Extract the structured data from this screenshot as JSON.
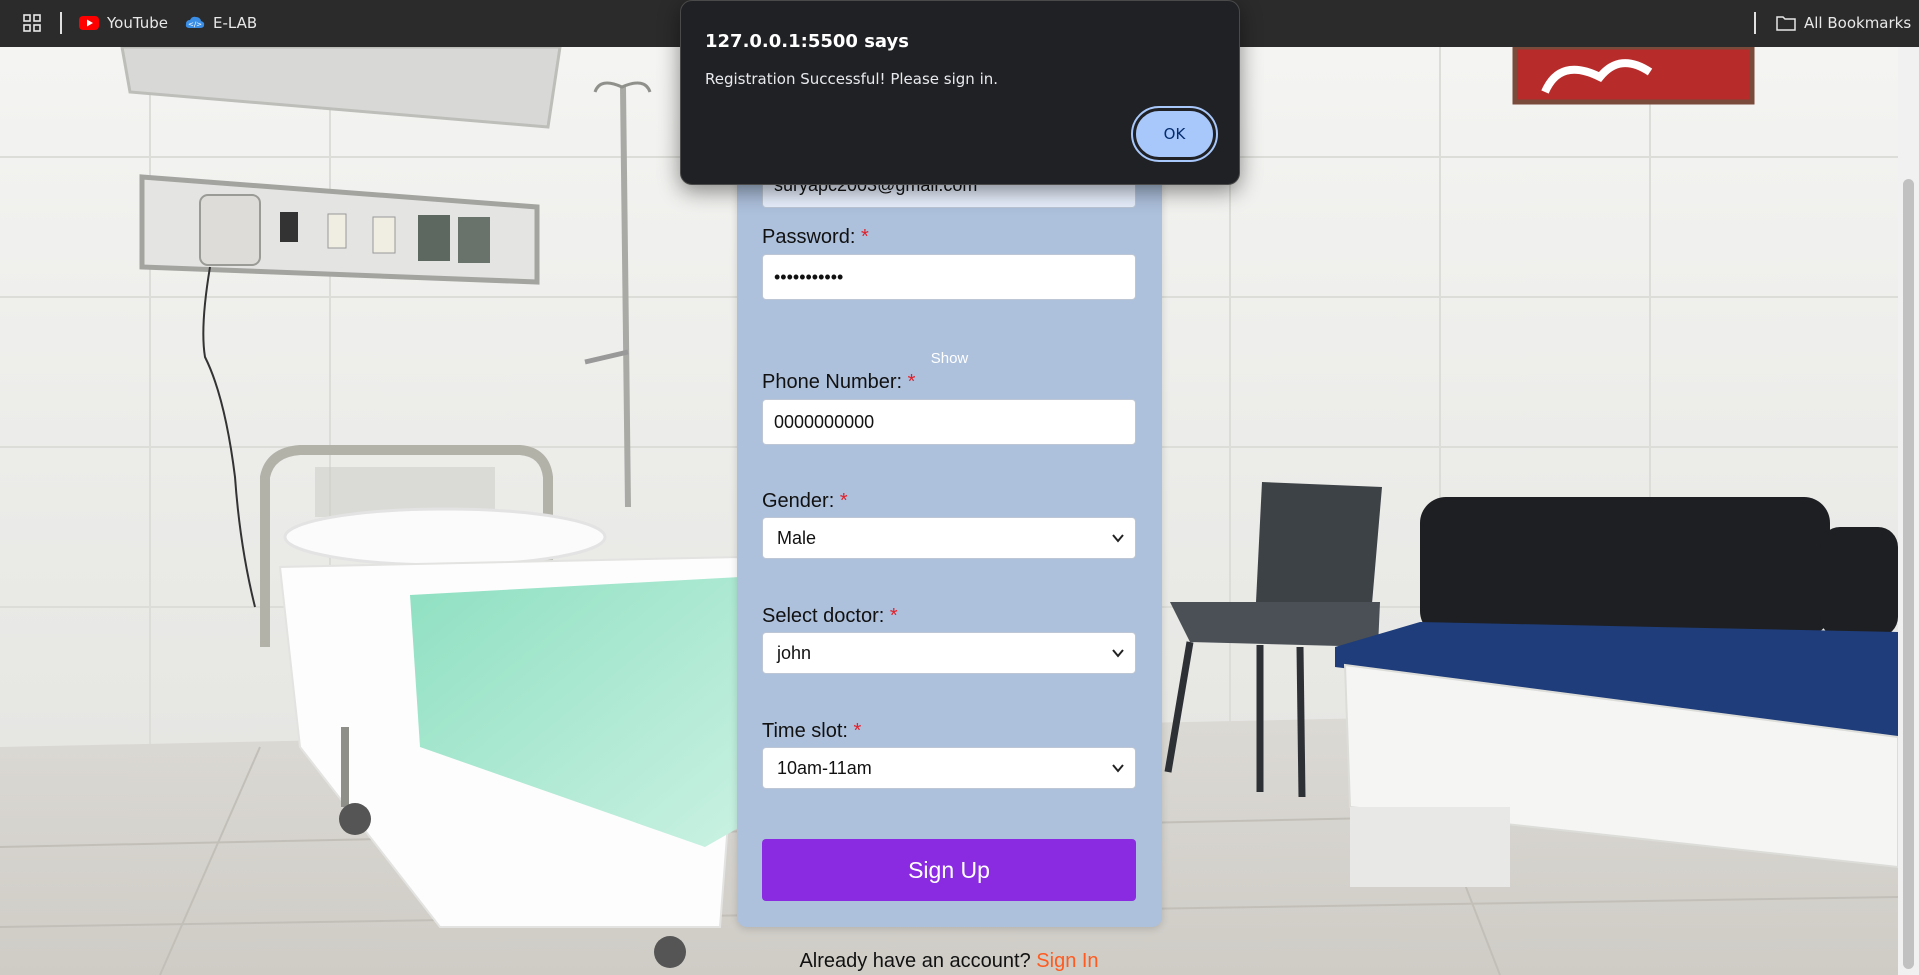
{
  "bookmarks": {
    "items": [
      {
        "label": "YouTube",
        "icon": "youtube-icon"
      },
      {
        "label": "E-LAB",
        "icon": "elab-icon"
      }
    ],
    "all_bookmarks_label": "All Bookmarks"
  },
  "alert": {
    "title": "127.0.0.1:5500 says",
    "message": "Registration Successful! Please sign in.",
    "ok_label": "OK"
  },
  "form": {
    "email": {
      "value": "suryapc2003@gmail.com"
    },
    "password": {
      "label": "Password:",
      "value": "•••••••••••",
      "show_label": "Show"
    },
    "phone": {
      "label": "Phone Number:",
      "value": "0000000000"
    },
    "gender": {
      "label": "Gender:",
      "selected": "Male"
    },
    "doctor": {
      "label": "Select doctor:",
      "selected": "john"
    },
    "timeslot": {
      "label": "Time slot:",
      "selected": "10am-11am"
    },
    "required_marker": "*",
    "submit_label": "Sign Up"
  },
  "footer": {
    "prompt": "Already have an account?",
    "signin_label": "Sign In"
  },
  "colors": {
    "panel": "#adc0dc",
    "submit": "#8a2be2",
    "link": "#ff5a1f",
    "required": "#e1202a",
    "dialog_bg": "#202124",
    "ok_button": "#a8c7fa"
  }
}
